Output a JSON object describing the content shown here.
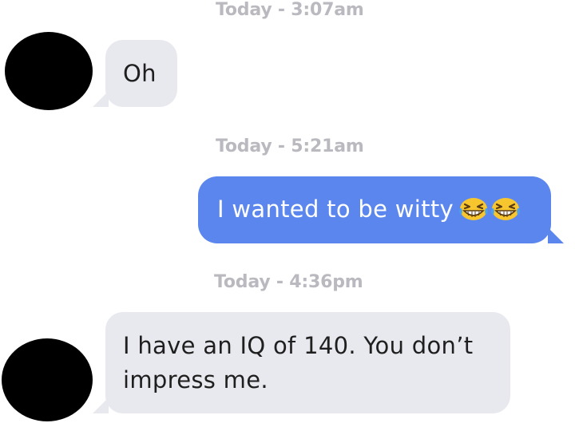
{
  "thread": {
    "messages": [
      {
        "timestamp": "Today - 3:07am",
        "direction": "incoming",
        "text": "Oh"
      },
      {
        "timestamp": "Today - 5:21am",
        "direction": "outgoing",
        "text": "I wanted to be witty",
        "emoji": [
          "grinning-squinting-face-icon",
          "grinning-squinting-face-icon"
        ]
      },
      {
        "timestamp": "Today - 4:36pm",
        "direction": "incoming",
        "lines": [
          "I have an IQ of 140. You don’t",
          "impress me."
        ]
      }
    ]
  },
  "colors": {
    "incoming_bubble": "#e8e9ee",
    "outgoing_bubble": "#5a86ee",
    "timestamp_text": "#b9b9bf",
    "avatar": "#000000"
  }
}
